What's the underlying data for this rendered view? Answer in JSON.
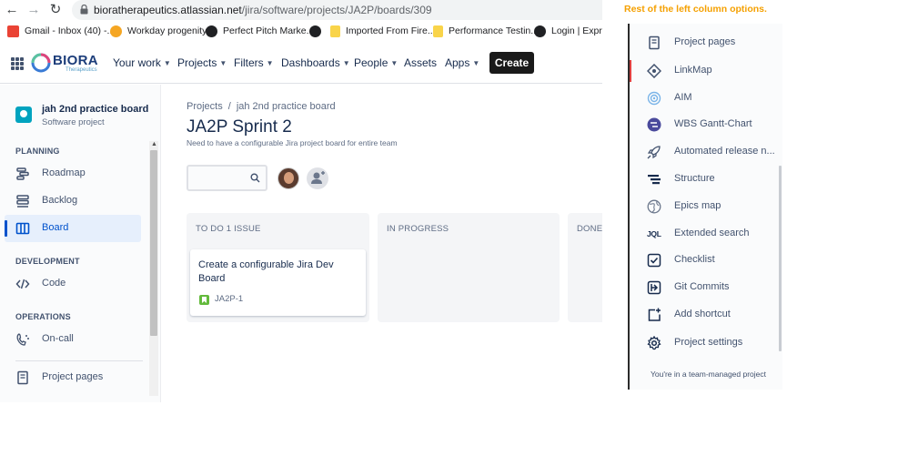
{
  "browser": {
    "url_host": "bioratherapeutics.atlassian.net",
    "url_path": "/jira/software/projects/JA2P/boards/309",
    "bookmarks": [
      {
        "label": "Gmail - Inbox (40) -...",
        "color": "#ea4335"
      },
      {
        "label": "Workday progenity",
        "color": "#f5a623"
      },
      {
        "label": "Perfect Pitch Marke...",
        "color": "#202124"
      },
      {
        "label": "",
        "color": "#202124"
      },
      {
        "label": "Imported From Fire...",
        "color": "#f9d44a"
      },
      {
        "label": "Performance Testin...",
        "color": "#f9d44a"
      },
      {
        "label": "Login | Express",
        "color": "#202124"
      }
    ]
  },
  "topnav": {
    "logo_name": "BIORA",
    "logo_sub": "Therapeutics",
    "items": [
      "Your work",
      "Projects",
      "Filters",
      "Dashboards",
      "People",
      "Assets",
      "Apps"
    ],
    "create_label": "Create"
  },
  "sidebar": {
    "project_name": "jah 2nd practice board",
    "project_type": "Software project",
    "planning_heading": "PLANNING",
    "planning_items": [
      "Roadmap",
      "Backlog",
      "Board"
    ],
    "development_heading": "DEVELOPMENT",
    "development_items": [
      "Code"
    ],
    "operations_heading": "OPERATIONS",
    "operations_items": [
      "On-call"
    ],
    "extra_items": [
      "Project pages"
    ]
  },
  "board": {
    "breadcrumb": [
      "Projects",
      "jah 2nd practice board"
    ],
    "title": "JA2P Sprint 2",
    "description": "Need to have a configurable Jira project board for entire team",
    "columns": [
      {
        "title": "TO DO 1 ISSUE"
      },
      {
        "title": "IN PROGRESS"
      },
      {
        "title": "DONE"
      }
    ],
    "card": {
      "summary": "Create a configurable Jira Dev Board",
      "key": "JA2P-1"
    }
  },
  "annotation": "Rest of the left column options.",
  "panel": {
    "items": [
      {
        "label": "Project pages",
        "icon": "page-icon"
      },
      {
        "label": "LinkMap",
        "icon": "linkmap-icon"
      },
      {
        "label": "AIM",
        "icon": "aim-icon"
      },
      {
        "label": "WBS Gantt-Chart",
        "icon": "gantt-icon"
      },
      {
        "label": "Automated release n...",
        "icon": "rocket-icon"
      },
      {
        "label": "Structure",
        "icon": "structure-icon"
      },
      {
        "label": "Epics map",
        "icon": "globe-icon"
      },
      {
        "label": "Extended search",
        "icon": "jql-icon"
      },
      {
        "label": "Checklist",
        "icon": "checklist-icon"
      },
      {
        "label": "Git Commits",
        "icon": "git-icon"
      },
      {
        "label": "Add shortcut",
        "icon": "add-shortcut-icon"
      },
      {
        "label": "Project settings",
        "icon": "gear-icon"
      }
    ],
    "jql_glyph": "JQL",
    "footer_note": "You're in a team-managed project"
  }
}
